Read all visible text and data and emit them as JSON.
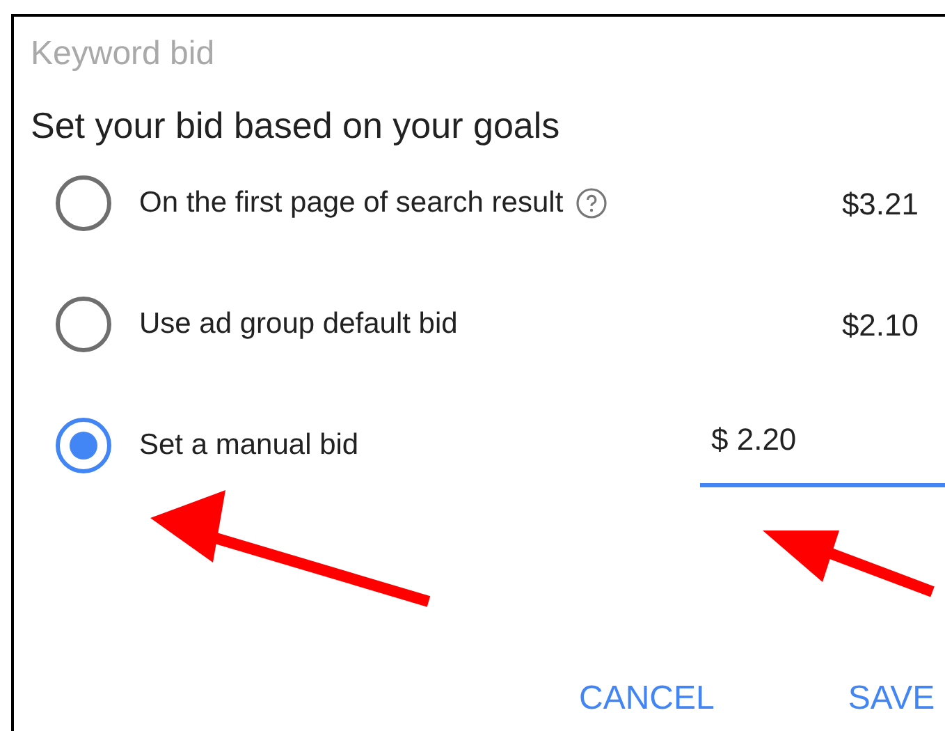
{
  "dialog": {
    "title": "Keyword bid",
    "subtitle": "Set your bid based on your goals"
  },
  "options": [
    {
      "kind": "price",
      "label": "On the first page of search result",
      "help": true,
      "price": "$3.21",
      "selected": false
    },
    {
      "kind": "price",
      "label": "Use ad group default bid",
      "price": "$2.10",
      "selected": false
    },
    {
      "kind": "input",
      "label": "Set a manual bid",
      "value": "$ 2.20",
      "selected": true
    }
  ],
  "buttons": [
    "CANCEL",
    "SAVE"
  ]
}
